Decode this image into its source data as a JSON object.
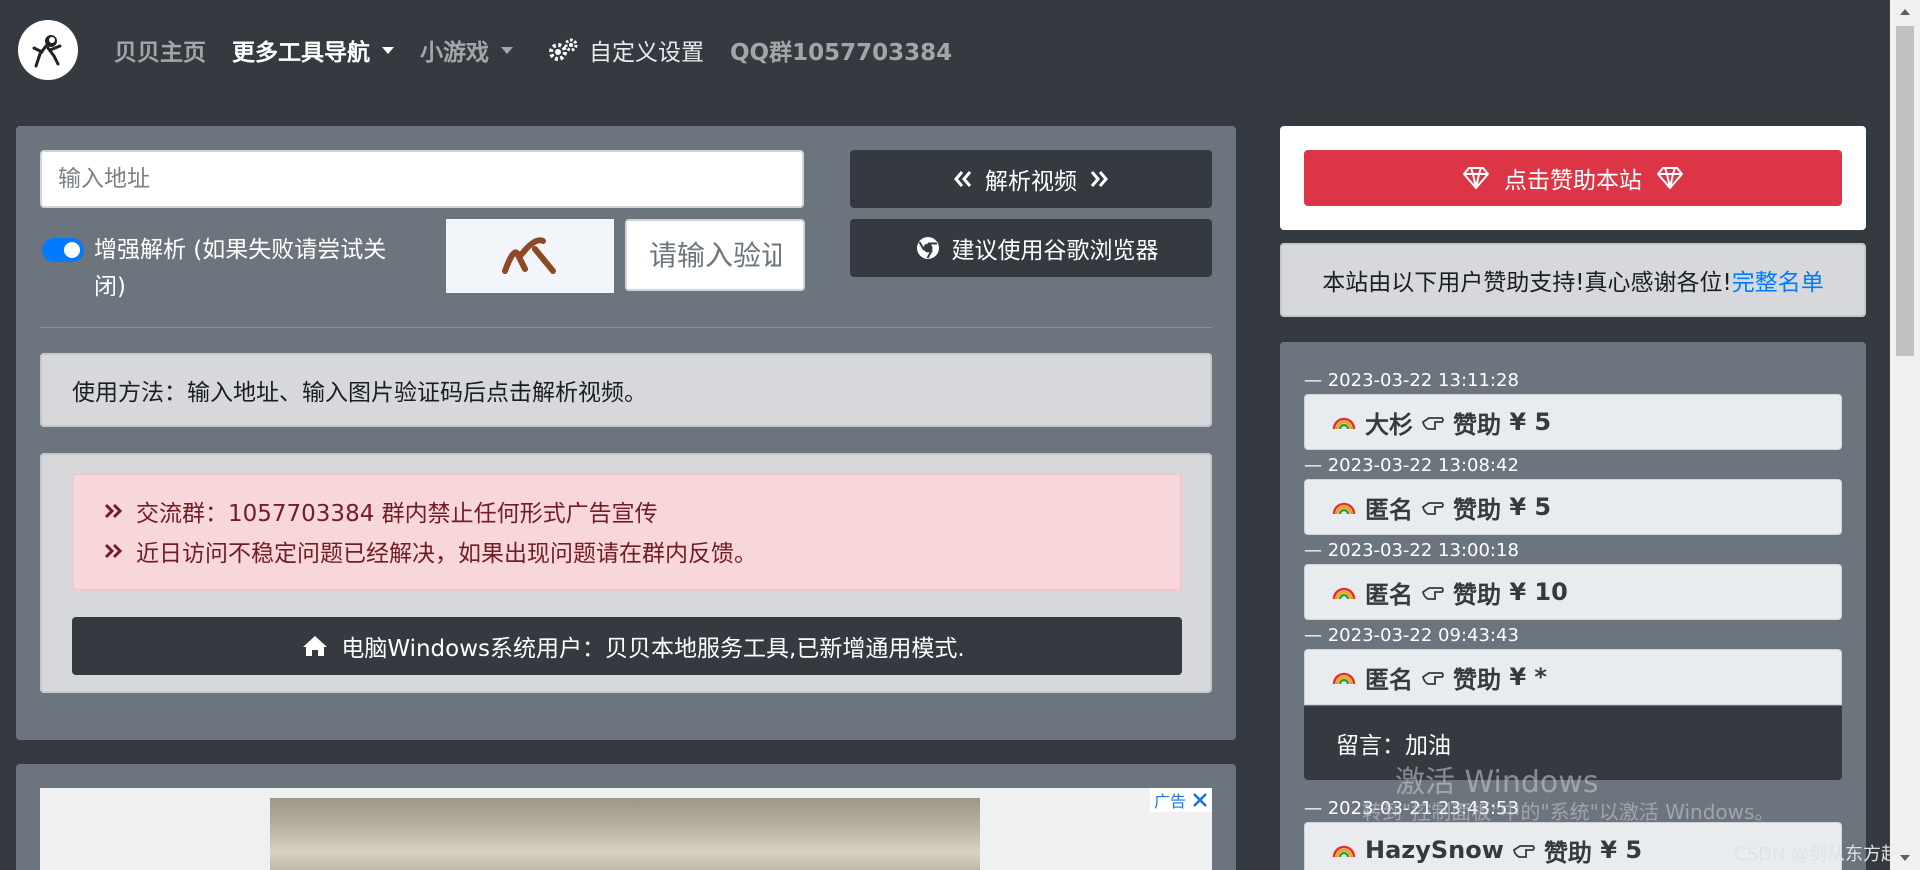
{
  "nav": {
    "home": "贝贝主页",
    "more_tools": "更多工具导航",
    "games": "小游戏",
    "settings": "自定义设置",
    "qq_group": "QQ群1057703384"
  },
  "parser": {
    "url_placeholder": "输入地址",
    "parse_button": "解析视频",
    "enhance_toggle_label": "增强解析 (如果失败请尝试关闭)",
    "captcha_placeholder": "请输入验证",
    "chrome_button": "建议使用谷歌浏览器"
  },
  "usage_text": "使用方法：输入地址、输入图片验证码后点击解析视频。",
  "notices": [
    "交流群：1057703384 群内禁止任何形式广告宣传",
    "近日访问不稳定问题已经解决，如果出现问题请在群内反馈。"
  ],
  "windows_button": "电脑Windows系统用户：贝贝本地服务工具,已新增通用模式.",
  "ad": {
    "badge": "广告"
  },
  "sponsor": {
    "button": "点击赞助本站",
    "thanks_text": "本站由以下用户赞助支持!真心感谢各位!",
    "full_list_link": "完整名单"
  },
  "donors": [
    {
      "time": "— 2023-03-22 13:11:28",
      "name": "大杉",
      "action": "赞助",
      "amount": "¥ 5"
    },
    {
      "time": "— 2023-03-22 13:08:42",
      "name": "匿名",
      "action": "赞助",
      "amount": "¥ 5"
    },
    {
      "time": "— 2023-03-22 13:00:18",
      "name": "匿名",
      "action": "赞助",
      "amount": "¥ 10"
    },
    {
      "time": "— 2023-03-22 09:43:43",
      "name": "匿名",
      "action": "赞助",
      "amount": "¥ *"
    },
    {
      "time": "— 2023-03-21 23:43:53",
      "name": "HazySnow",
      "action": "赞助",
      "amount": "¥ 5"
    }
  ],
  "donor_message": "留言：加油",
  "overlay": {
    "activate_title": "激活 Windows",
    "activate_sub": "转到\"控制面板\"中的\"系统\"以激活 Windows。",
    "csdn": "CSDN @剑从东方起"
  },
  "colors": {
    "navbar_bg": "#343a40",
    "panel_bg": "#6c757d",
    "primary": "#007bff",
    "danger": "#dc3545",
    "alert_pink": "#f8d7da"
  }
}
